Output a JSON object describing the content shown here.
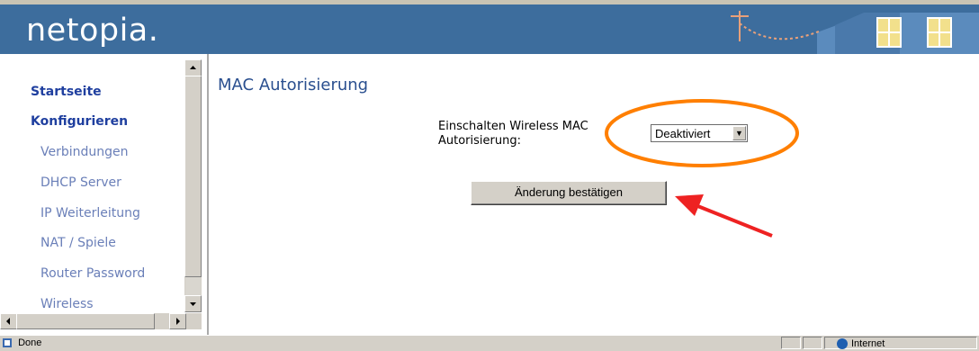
{
  "header": {
    "logo_text": "netopia."
  },
  "sidebar": {
    "items": [
      {
        "label": "Startseite",
        "level": "main"
      },
      {
        "label": "Konfigurieren",
        "level": "main"
      },
      {
        "label": "Verbindungen",
        "level": "sub"
      },
      {
        "label": "DHCP Server",
        "level": "sub"
      },
      {
        "label": "IP Weiterleitung",
        "level": "sub"
      },
      {
        "label": "NAT / Spiele",
        "level": "sub"
      },
      {
        "label": "Router Password",
        "level": "sub"
      },
      {
        "label": "Wireless",
        "level": "sub"
      }
    ]
  },
  "main": {
    "title": "MAC Autorisierung",
    "field_label": "Einschalten Wireless MAC Autorisierung:",
    "select_value": "Deaktiviert",
    "submit_label": "Änderung bestätigen"
  },
  "statusbar": {
    "status_text": "Done",
    "zone_text": "Internet"
  },
  "colors": {
    "header_bg": "#3d6d9d",
    "nav_main": "#1f3f9f",
    "nav_sub": "#6a7fb8",
    "annotation": "#ff7f00"
  }
}
